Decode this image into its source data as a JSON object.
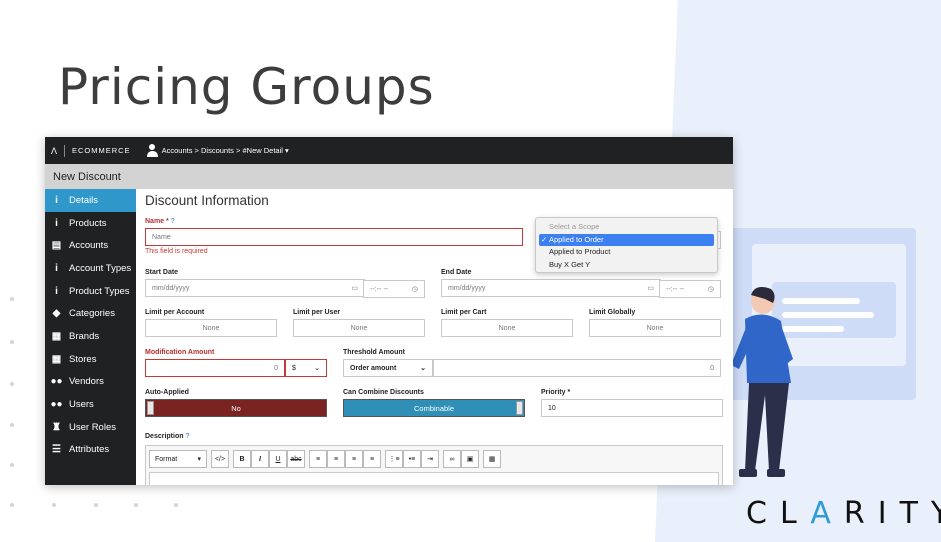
{
  "slide": {
    "title": "Pricing Groups",
    "brand_prefix": "CL",
    "brand_accent": "A",
    "brand_suffix": "RITY"
  },
  "app": {
    "logo_text": "ECOMMERCE",
    "breadcrumb": "Accounts > Discounts > #New Detail ▾",
    "subheader": "New Discount",
    "sidebar": [
      {
        "label": "Details",
        "icon": "i",
        "icon_name": "info-icon",
        "active": true
      },
      {
        "label": "Products",
        "icon": "i",
        "icon_name": "info-icon"
      },
      {
        "label": "Accounts",
        "icon": "▤",
        "icon_name": "id-card-icon"
      },
      {
        "label": "Account Types",
        "icon": "i",
        "icon_name": "info-icon"
      },
      {
        "label": "Product Types",
        "icon": "i",
        "icon_name": "info-icon"
      },
      {
        "label": "Categories",
        "icon": "◆",
        "icon_name": "tags-icon"
      },
      {
        "label": "Brands",
        "icon": "▦",
        "icon_name": "building-icon"
      },
      {
        "label": "Stores",
        "icon": "▦",
        "icon_name": "building-icon"
      },
      {
        "label": "Vendors",
        "icon": "●●",
        "icon_name": "users-icon"
      },
      {
        "label": "Users",
        "icon": "●●",
        "icon_name": "users-icon"
      },
      {
        "label": "User Roles",
        "icon": "♜",
        "icon_name": "user-roles-icon"
      },
      {
        "label": "Attributes",
        "icon": "☰",
        "icon_name": "list-icon"
      }
    ],
    "form": {
      "section_title": "Discount Information",
      "name_label": "Name *",
      "name_placeholder": "Name",
      "name_error": "This field is required",
      "scope_options": [
        "Select a Scope",
        "✓ Applied to Order",
        "Applied to Product",
        "Buy X Get Y"
      ],
      "start_date_label": "Start Date",
      "end_date_label": "End Date",
      "date_placeholder": "mm/dd/yyyy",
      "time_placeholder": "--:-- --",
      "limit_per_account_label": "Limit per Account",
      "limit_per_user_label": "Limit per User",
      "limit_per_cart_label": "Limit per Cart",
      "limit_globally_label": "Limit Globally",
      "none_text": "None",
      "modification_amount_label": "Modification Amount",
      "modification_amount_value": "0",
      "currency": "$",
      "threshold_amount_label": "Threshold Amount",
      "threshold_type": "Order amount",
      "threshold_value": "0",
      "auto_applied_label": "Auto-Applied",
      "auto_applied_value": "No",
      "can_combine_label": "Can Combine Discounts",
      "can_combine_value": "Combinable",
      "priority_label": "Priority *",
      "priority_value": "10",
      "description_label": "Description",
      "format_label": "Format"
    },
    "colors": {
      "active_nav": "#2f97c9",
      "no_toggle": "#7b2323",
      "combinable_toggle": "#2f8fb6",
      "error": "#c23a3a"
    }
  }
}
